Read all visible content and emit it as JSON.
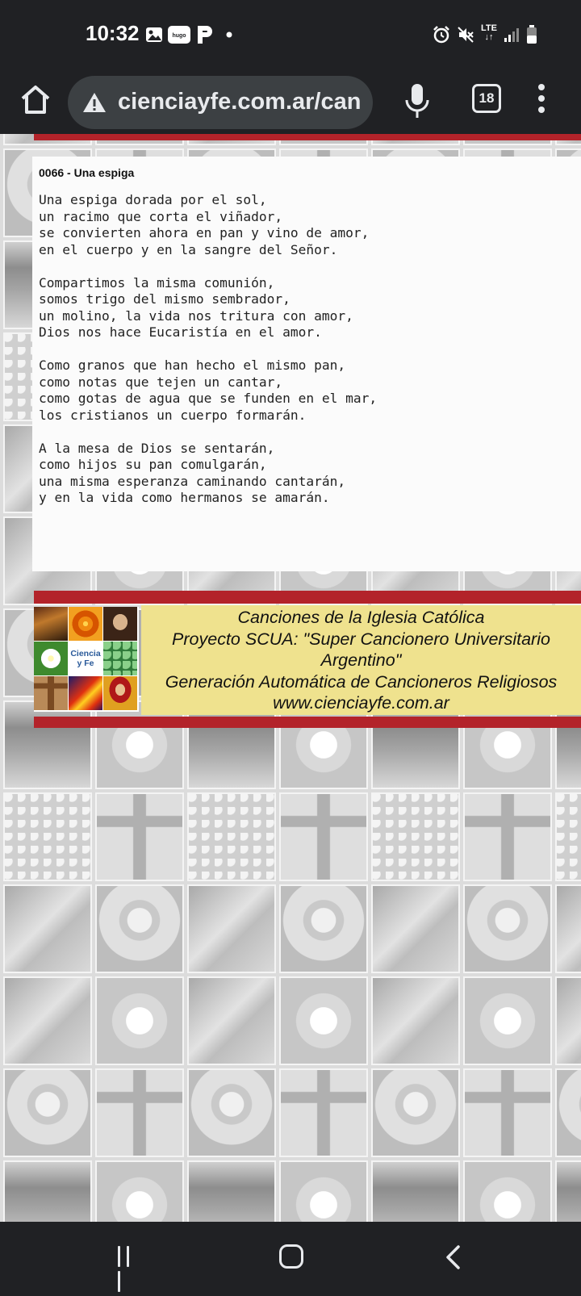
{
  "status_bar": {
    "time": "10:32",
    "icons": [
      "gallery-icon",
      "hugo-icon",
      "p-icon",
      "dot-icon",
      "alarm-icon",
      "mute-icon",
      "lte-icon",
      "signal-icon",
      "battery-icon"
    ],
    "hugo_label": "hugo",
    "lte_label": "LTE"
  },
  "browser": {
    "url": "cienciayfe.com.ar/can",
    "tab_count": "18",
    "icons": [
      "home-icon",
      "warning-icon",
      "mic-icon",
      "menu-icon"
    ]
  },
  "song": {
    "title": "0066 - Una espiga",
    "lyrics": "Una espiga dorada por el sol,\nun racimo que corta el viñador,\nse convierten ahora en pan y vino de amor,\nen el cuerpo y en la sangre del Señor.\n\nCompartimos la misma comunión,\nsomos trigo del mismo sembrador,\nun molino, la vida nos tritura con amor,\nDios nos hace Eucaristía en el amor.\n\nComo granos que han hecho el mismo pan,\ncomo notas que tejen un cantar,\ncomo gotas de agua que se funden en el mar,\nlos cristianos un cuerpo formarán.\n\nA la mesa de Dios se sentarán,\ncomo hijos su pan comulgarán,\nuna misma esperanza caminando cantarán,\ny en la vida como hermanos se amarán."
  },
  "footer": {
    "logo_text": "Ciencia y Fe",
    "line1": "Canciones de la Iglesia Católica",
    "line2": "Proyecto SCUA: \"Super Cancionero Universitario",
    "line3": "Argentino\"",
    "line4": "Generación Automática de Cancioneros Religiosos",
    "line5": "www.cienciayfe.com.ar"
  },
  "colors": {
    "accent_red": "#b3232a",
    "footer_yellow": "#efe28e",
    "system_bar": "#202124"
  },
  "nav_bar": {
    "icons": [
      "recents-icon",
      "home-circle-icon",
      "back-icon"
    ]
  }
}
